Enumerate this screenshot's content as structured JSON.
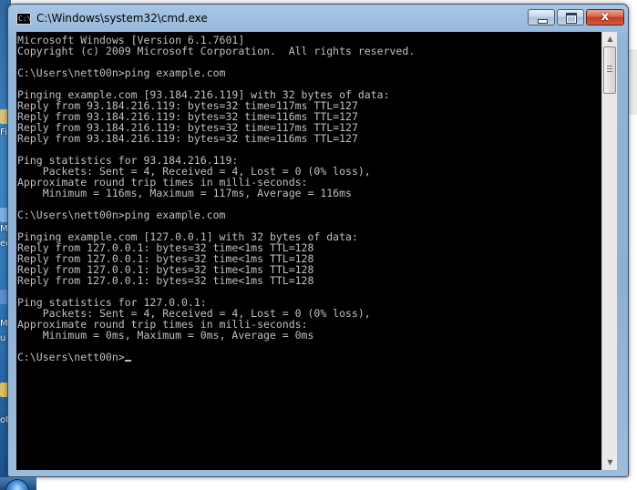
{
  "window": {
    "title": "C:\\Windows\\system32\\cmd.exe",
    "icon": "cmd-icon",
    "controls": {
      "minimize_icon": "minimize-icon",
      "maximize_icon": "maximize-icon",
      "close_glyph": "x"
    }
  },
  "console": {
    "lines": [
      "Microsoft Windows [Version 6.1.7601]",
      "Copyright (c) 2009 Microsoft Corporation.  All rights reserved.",
      "",
      "C:\\Users\\nett00n>ping example.com",
      "",
      "Pinging example.com [93.184.216.119] with 32 bytes of data:",
      "Reply from 93.184.216.119: bytes=32 time=117ms TTL=127",
      "Reply from 93.184.216.119: bytes=32 time=116ms TTL=127",
      "Reply from 93.184.216.119: bytes=32 time=117ms TTL=127",
      "Reply from 93.184.216.119: bytes=32 time=116ms TTL=127",
      "",
      "Ping statistics for 93.184.216.119:",
      "    Packets: Sent = 4, Received = 4, Lost = 0 (0% loss),",
      "Approximate round trip times in milli-seconds:",
      "    Minimum = 116ms, Maximum = 117ms, Average = 116ms",
      "",
      "C:\\Users\\nett00n>ping example.com",
      "",
      "Pinging example.com [127.0.0.1] with 32 bytes of data:",
      "Reply from 127.0.0.1: bytes=32 time<1ms TTL=128",
      "Reply from 127.0.0.1: bytes=32 time<1ms TTL=128",
      "Reply from 127.0.0.1: bytes=32 time<1ms TTL=128",
      "Reply from 127.0.0.1: bytes=32 time<1ms TTL=128",
      "",
      "Ping statistics for 127.0.0.1:",
      "    Packets: Sent = 4, Received = 4, Lost = 0 (0% loss),",
      "Approximate round trip times in milli-seconds:",
      "    Minimum = 0ms, Maximum = 0ms, Average = 0ms",
      ""
    ],
    "prompt": "C:\\Users\\nett00n>",
    "text_color": "#c0c0c0",
    "background_color": "#000000"
  },
  "scrollbar": {
    "up_icon": "scroll-up-arrow-icon",
    "down_icon": "scroll-down-arrow-icon"
  },
  "desktop": {
    "fragments": [
      "Fi",
      "Mi",
      "ec",
      "M",
      "u",
      "ot"
    ]
  },
  "colors": {
    "title_bar": "#91b4d8",
    "close_button": "#c23a22",
    "desktop": "#3c86c3"
  }
}
